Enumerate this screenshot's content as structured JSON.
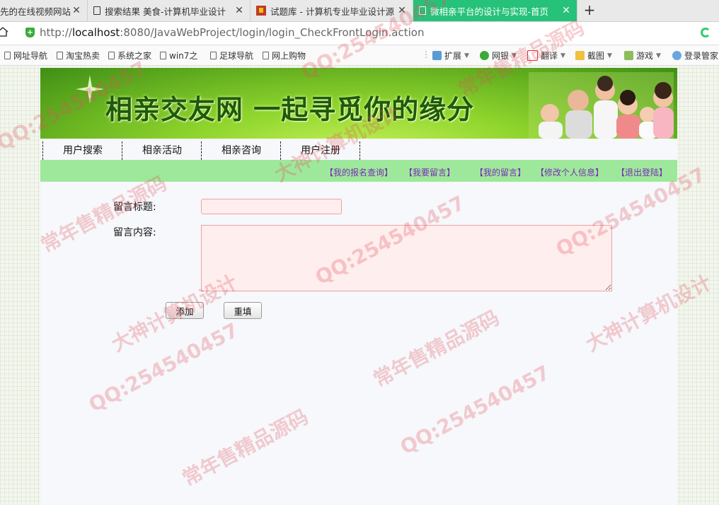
{
  "browser": {
    "tabs": [
      {
        "title": "先的在线视频网站",
        "icon": "none",
        "active": false
      },
      {
        "title": "搜索结果 美食-计算机毕业设计",
        "icon": "page-icon",
        "active": false
      },
      {
        "title": "试题库 - 计算机专业毕业设计源",
        "icon": "site-icon",
        "active": false
      },
      {
        "title": "微相亲平台的设计与实现-首页",
        "icon": "page-icon",
        "active": true
      }
    ],
    "new_tab_label": "+",
    "close_label": "✕",
    "url_scheme": "http://",
    "url_host": "localhost",
    "url_rest": ":8080/JavaWebProject/login/login_CheckFrontLogin.action",
    "bookmarks": [
      "网址导航",
      "淘宝热卖",
      "系统之家",
      "win7之",
      "足球导航",
      "网上购物"
    ],
    "tools": [
      "扩展",
      "网银",
      "翻译",
      "截图",
      "游戏",
      "登录管家"
    ],
    "accent_color": "#27c27a"
  },
  "banner": {
    "title": "相亲交友网 一起寻觅你的缘分"
  },
  "nav": {
    "items": [
      "用户搜索",
      "相亲活动",
      "相亲咨询",
      "用户注册"
    ]
  },
  "subnav": {
    "links": [
      "【我的报名查询】",
      "【我要留言】",
      "【我的留言】",
      "【修改个人信息】",
      "【退出登陆】"
    ],
    "link_color": "#7a2bb5",
    "bar_color": "#9ee89b"
  },
  "form": {
    "title_label": "留言标题:",
    "title_value": "",
    "content_label": "留言内容:",
    "content_value": "",
    "add_label": "添加",
    "reset_label": "重填"
  },
  "watermark": {
    "texts": [
      "QQ:254540457",
      "常年售精品源码",
      "大神计算机设计"
    ]
  }
}
